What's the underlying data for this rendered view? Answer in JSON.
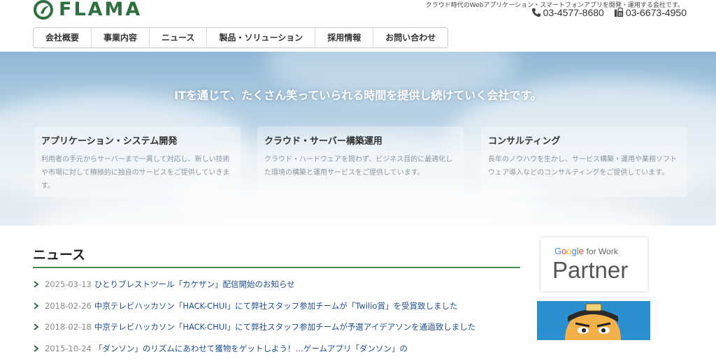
{
  "header": {
    "logo_text": "FLAMA",
    "tagline": "クラウド時代のWebアプリケーション・スマートフォンアプリを開発・運用する会社です。",
    "phone": "03-4577-8680",
    "fax": "03-6673-4950"
  },
  "nav": {
    "items": [
      {
        "label": "会社概要"
      },
      {
        "label": "事業内容"
      },
      {
        "label": "ニュース"
      },
      {
        "label": "製品・ソリューション"
      },
      {
        "label": "採用情報"
      },
      {
        "label": "お問い合わせ"
      }
    ]
  },
  "hero": {
    "title": "ITを通じて、たくさん笑っていられる時間を提供し続けていく会社です。",
    "cards": [
      {
        "title": "アプリケーション・システム開発",
        "body": "利用者の手元からサーバーまで一貫して対応し、新しい技術や市場に対して積極的に独自のサービスをご提供していきます。"
      },
      {
        "title": "クラウド・サーバー構築運用",
        "body": "クラウド・ハードウェアを問わず、ビジネス目的に最適化した環境の構築と運用サービスをご提供しています。"
      },
      {
        "title": "コンサルティング",
        "body": "長年のノウハウを生かし、サービス構築・運用や業務ソフトウェア導入などのコンサルティングをご提供しています。"
      }
    ]
  },
  "news": {
    "heading": "ニュース",
    "items": [
      {
        "date": "2025-03-13",
        "title": "ひとりブレストツール「カケザン」配信開始のお知らせ"
      },
      {
        "date": "2018-02-26",
        "title": "中京テレビハッカソン「HACK-CHUI」にて弊社スタッフ参加チームが「Twilio賞」を受賞致しました"
      },
      {
        "date": "2018-02-18",
        "title": "中京テレビハッカソン「HACK-CHUI」にて弊社スタッフ参加チームが予選アイデアソンを通過致しました"
      },
      {
        "date": "2015-10-24",
        "title": "「ダンソン」のリズムにあわせて獲物をゲットしよう！…ゲームアプリ「ダンソン」の"
      }
    ]
  },
  "sidebar": {
    "partner_google": "Google",
    "partner_for_work": "for Work",
    "partner_big": "Partner"
  },
  "colors": {
    "brand_green": "#2f6f3f",
    "link_blue": "#1f4e8c"
  }
}
